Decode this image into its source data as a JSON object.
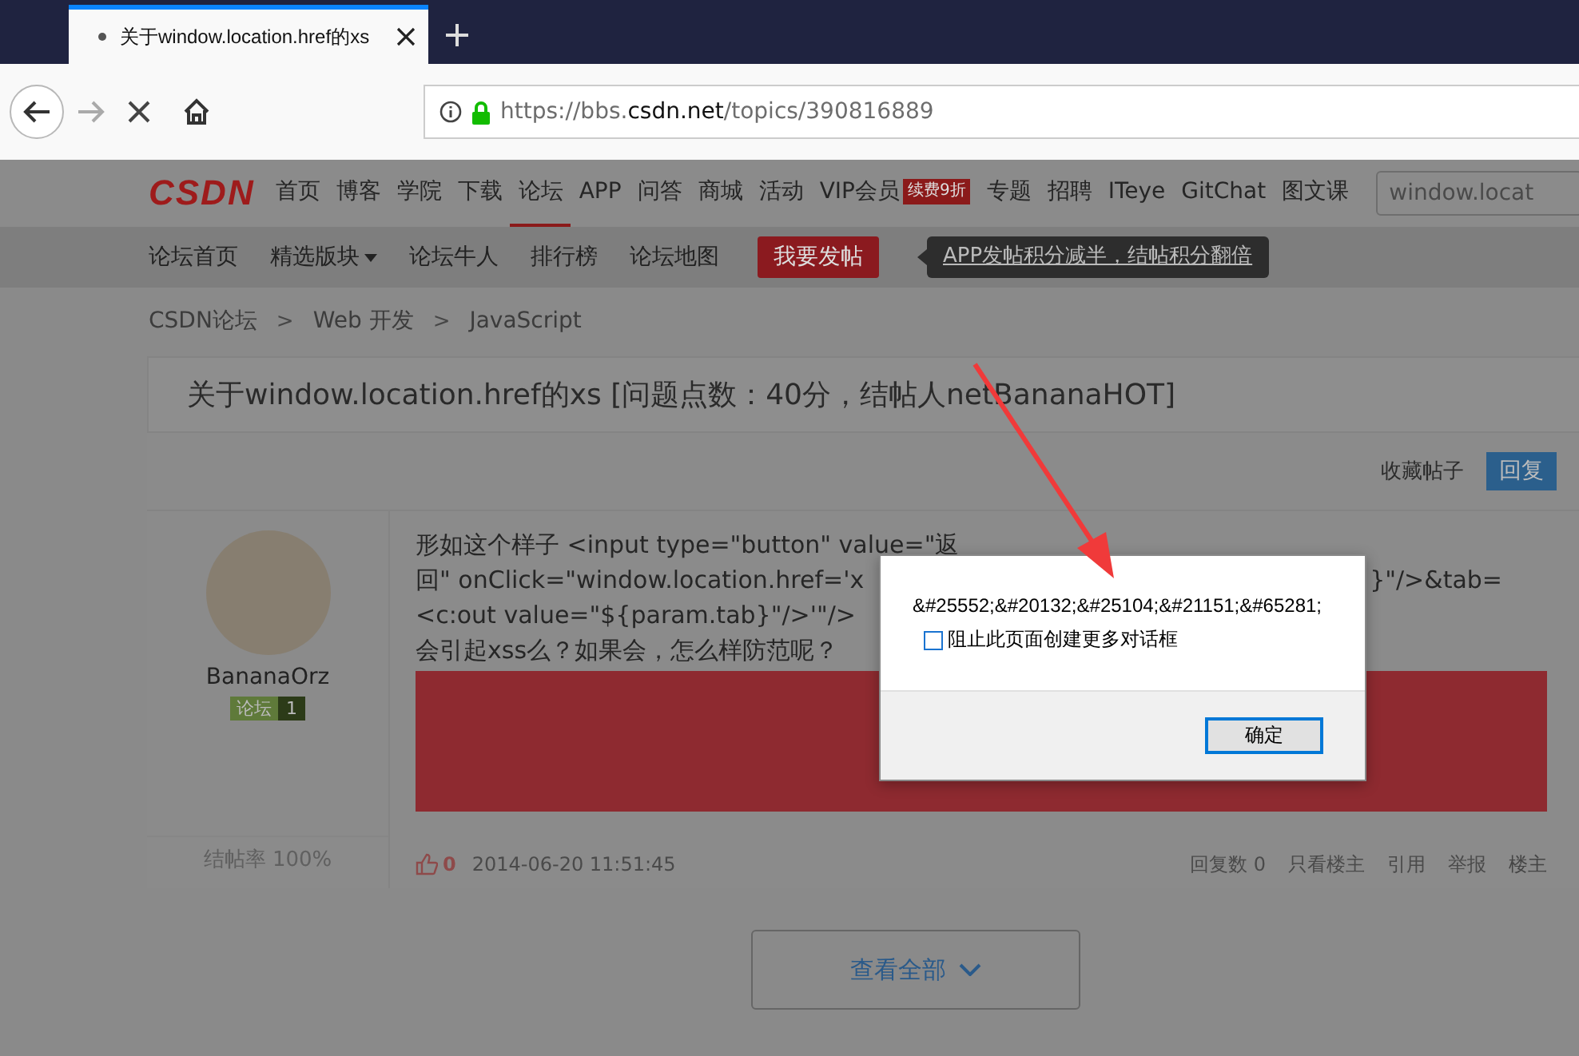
{
  "browser": {
    "tab": {
      "title": "关于window.location.href的xs"
    },
    "url": {
      "prefix": "https://bbs.",
      "domain": "csdn.net",
      "path": "/topics/390816889"
    }
  },
  "site_nav": {
    "logo": "CSDN",
    "items": [
      {
        "label": "首页",
        "selected": false
      },
      {
        "label": "博客",
        "selected": false
      },
      {
        "label": "学院",
        "selected": false
      },
      {
        "label": "下载",
        "selected": false
      },
      {
        "label": "论坛",
        "selected": true
      },
      {
        "label": "APP",
        "selected": false
      },
      {
        "label": "问答",
        "selected": false
      },
      {
        "label": "商城",
        "selected": false
      },
      {
        "label": "活动",
        "selected": false
      },
      {
        "label": "VIP会员",
        "selected": false,
        "badge": "续费9折"
      },
      {
        "label": "专题",
        "selected": false
      },
      {
        "label": "招聘",
        "selected": false
      },
      {
        "label": "ITeye",
        "selected": false
      },
      {
        "label": "GitChat",
        "selected": false
      },
      {
        "label": "图文课",
        "selected": false
      }
    ],
    "search": {
      "value": "window.locat"
    }
  },
  "sub_nav": {
    "items": [
      {
        "label": "论坛首页",
        "dropdown": false
      },
      {
        "label": "精选版块",
        "dropdown": true
      },
      {
        "label": "论坛牛人",
        "dropdown": false
      },
      {
        "label": "排行榜",
        "dropdown": false
      },
      {
        "label": "论坛地图",
        "dropdown": false
      }
    ],
    "post_button": "我要发帖",
    "tip": "APP发帖积分减半，结帖积分翻倍"
  },
  "breadcrumb": [
    {
      "kind": "link",
      "text": "CSDN论坛"
    },
    {
      "kind": "separator",
      "text": ">"
    },
    {
      "kind": "link",
      "text": "Web 开发"
    },
    {
      "kind": "separator",
      "text": ">"
    },
    {
      "kind": "link",
      "text": "JavaScript"
    }
  ],
  "topic": {
    "title": "关于window.location.href的xs [问题点数：40分，结帖人netBananaHOT]",
    "favorite": "收藏帖子",
    "reply": "回复"
  },
  "post": {
    "author": {
      "name": "BananaOrz",
      "tag": "论坛",
      "level": "1"
    },
    "close_rate": "结帖率 100%",
    "body_lines": [
      {
        "text": "形如这个样子 <input type=\"button\" value=\"返"
      },
      {
        "text": "回\" onClick=\"window.location.href='x",
        "tail": "}\"/>&tab="
      },
      {
        "text": "<c:out value=\"${param.tab}\"/>'\"/>"
      },
      {
        "text": "会引起xss么？如果会，怎么样防范呢？"
      }
    ],
    "likes": "0",
    "date": "2014-06-20 11:51:45",
    "meta": [
      {
        "label": "回复数",
        "count": "0"
      },
      {
        "label": "只看楼主"
      },
      {
        "label": "引用"
      },
      {
        "label": "举报"
      },
      {
        "label": "楼主"
      }
    ]
  },
  "view_all": "查看全部",
  "dialog": {
    "message": "&#25552;&#20132;&#25104;&#21151;&#65281;",
    "checkbox": {
      "label": "阻止此页面创建更多对话框",
      "checked": false
    },
    "ok_button": "确定"
  }
}
